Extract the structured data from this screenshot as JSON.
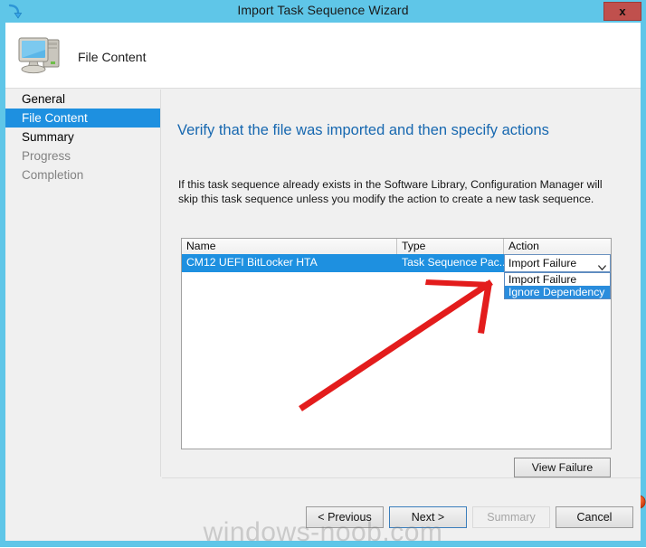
{
  "window": {
    "title": "Import Task Sequence Wizard",
    "close_label": "x",
    "title_icon": "import-arrow-icon",
    "header_icon": "computer-icon",
    "header_title": "File Content",
    "accent_color": "#5fc6e8",
    "close_color": "#c0504d"
  },
  "sidebar": {
    "items": [
      {
        "label": "General",
        "state": "normal"
      },
      {
        "label": "File Content",
        "state": "selected"
      },
      {
        "label": "Summary",
        "state": "normal"
      },
      {
        "label": "Progress",
        "state": "disabled"
      },
      {
        "label": "Completion",
        "state": "disabled"
      }
    ],
    "selected_color": "#1e90e0"
  },
  "main": {
    "heading": "Verify that the file was imported and then specify actions",
    "heading_color": "#1768b0",
    "description": "If this task sequence already exists in the Software Library, Configuration Manager will skip this task sequence unless you modify the action to create a new task sequence."
  },
  "listview": {
    "columns": [
      "Name",
      "Type",
      "Action"
    ],
    "rows": [
      {
        "name": "CM12 UEFI BitLocker HTA",
        "type": "Task Sequence Pac...",
        "action": "Import Failure",
        "selected": true
      }
    ],
    "action_dropdown": {
      "selected": "Import Failure",
      "open": true,
      "options": [
        {
          "label": "Import Failure",
          "highlighted": false
        },
        {
          "label": "Ignore Dependency",
          "highlighted": true
        }
      ],
      "chevron_icon": "chevron-down-icon"
    },
    "error_icon": "error-exclamation-icon",
    "error_icon_color": "#e8541e"
  },
  "actions": {
    "view_failure": "View Failure"
  },
  "buttons": {
    "previous": "< Previous",
    "next": "Next >",
    "summary": "Summary",
    "cancel": "Cancel",
    "next_focused": true,
    "summary_disabled": true
  },
  "watermark": {
    "text": "windows-noob.com"
  },
  "annotation": {
    "type": "hand-drawn-arrow",
    "color": "#e31c1c",
    "points": "tail (332,452) to head (545,310)"
  }
}
